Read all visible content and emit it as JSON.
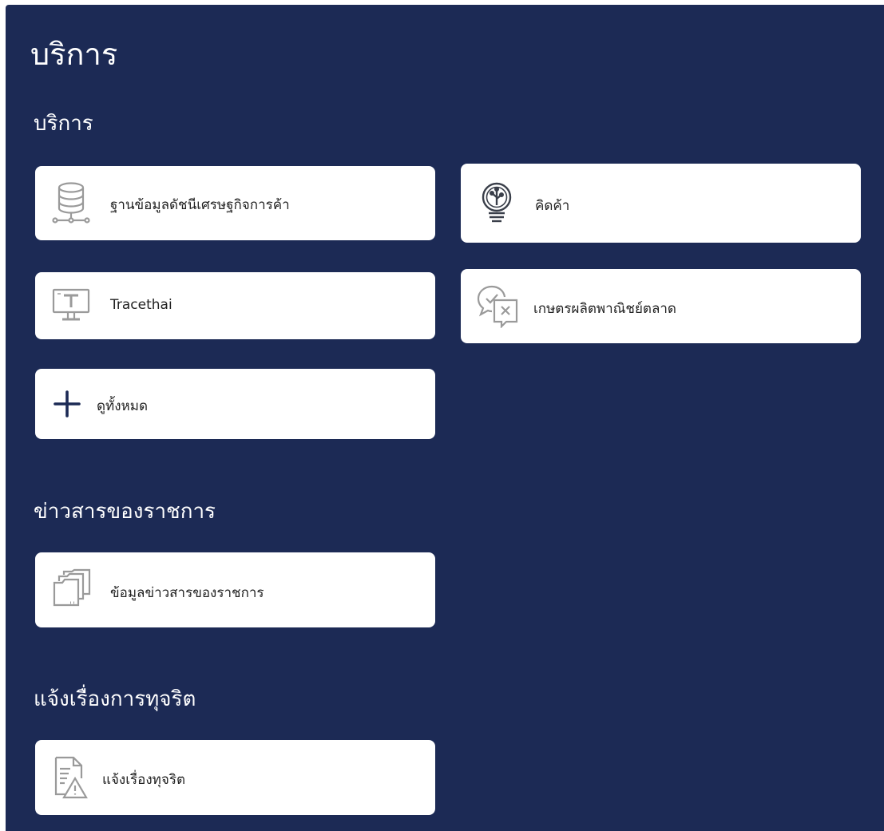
{
  "page": {
    "title": "บริการ"
  },
  "colors": {
    "panel_bg": "#1c2a55",
    "card_bg": "#ffffff",
    "icon_gray": "#9a9a9a",
    "icon_dark": "#1c2a55"
  },
  "services": {
    "title": "บริการ",
    "items": [
      {
        "label": "ฐานข้อมูลดัชนีเศรษฐกิจการค้า",
        "icon": "database-network-icon"
      },
      {
        "label": "คิดค้า",
        "icon": "lightbulb-icon"
      },
      {
        "label": "Tracethai",
        "icon": "monitor-icon"
      },
      {
        "label": "เกษตรผลิตพาณิชย์ตลาด",
        "icon": "chat-bubbles-icon"
      },
      {
        "label": "ดูทั้งหมด",
        "icon": "plus-icon"
      }
    ]
  },
  "news": {
    "title": "ข่าวสารของราชการ",
    "items": [
      {
        "label": "ข้อมูลข่าวสารของราชการ",
        "icon": "folders-icon"
      }
    ]
  },
  "corruption": {
    "title": "แจ้งเรื่องการทุจริต",
    "items": [
      {
        "label": "แจ้งเรื่องทุจริต",
        "icon": "document-warning-icon"
      }
    ]
  }
}
